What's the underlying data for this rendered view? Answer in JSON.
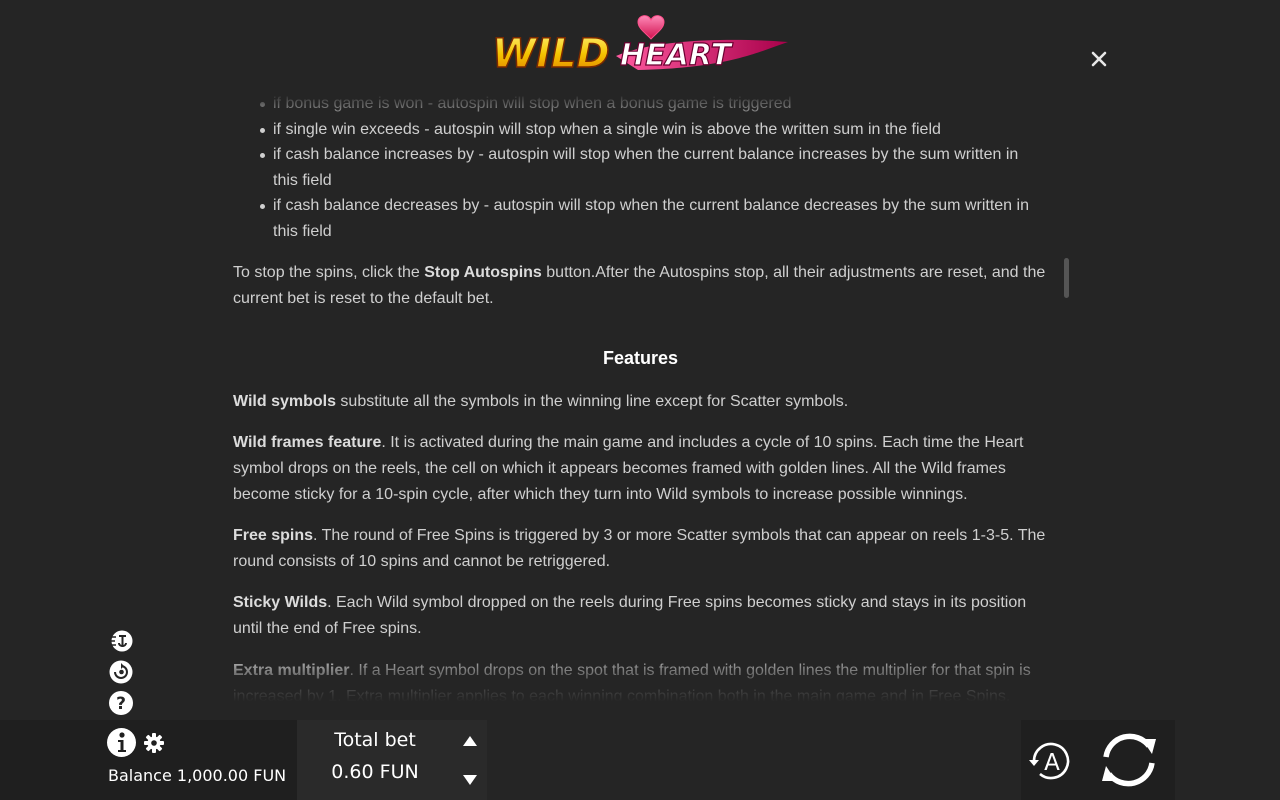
{
  "header": {
    "logo_text": "WILD HEART",
    "logo_word_1": "WILD",
    "logo_word_2": "HEART",
    "close_label": "×"
  },
  "rules": {
    "list_items": [
      "if bonus game is won - autospin will stop when a bonus game is triggered",
      "if single win exceeds - autospin will stop when a single win is above the written sum in the field",
      "if cash balance increases by - autospin will stop when the current balance increases by the sum written in this field",
      "if cash balance decreases by - autospin will stop when the current balance decreases by the sum written in this field"
    ],
    "stop": {
      "prefix": "To stop the spins, click the ",
      "bold": "Stop Autospins",
      "suffix": " button.After the Autospins stop, all their adjustments are reset, and the current bet is reset to the default bet."
    },
    "features_heading": "Features",
    "features": [
      {
        "title": "Wild symbols",
        "text": " substitute all the symbols in the winning line except for Scatter symbols."
      },
      {
        "title": "Wild frames feature",
        "text": ". It is activated during the main game and includes a cycle of 10 spins. Each time the Heart symbol drops on the reels, the cell on which it appears becomes framed with golden lines. All the Wild frames become sticky for a 10-spin cycle, after which they turn into Wild symbols to increase possible winnings."
      },
      {
        "title": "Free spins",
        "text": ". The round of Free Spins is triggered by 3 or more Scatter symbols that can appear on reels 1-3-5. The round consists of 10 spins and cannot be retriggered."
      },
      {
        "title": "Sticky Wilds",
        "text": ". Each Wild symbol dropped on the reels during Free spins becomes sticky and stays in its position until the end of Free spins."
      },
      {
        "title": "Extra multiplier",
        "text": ". If a Heart symbol drops on the spot that is framed with golden lines the multiplier for that spin is increased by 1. Extra multiplier applies to each winning combination both in the main game and in Free Spins."
      }
    ]
  },
  "side_icons": [
    "turbo-icon",
    "autospin-icon",
    "help-icon"
  ],
  "help_glyph": "?",
  "bottom_bar": {
    "balance_label": "Balance",
    "balance_value": "1,000.00 FUN",
    "total_bet_label": "Total bet",
    "total_bet_value": "0.60 FUN",
    "autoplay_letter": "A"
  },
  "colors": {
    "background": "#252525",
    "text": "#cfcfcf",
    "heading": "#ffffff",
    "logo_gold": "#f5c400",
    "logo_pink": "#e0307a"
  }
}
